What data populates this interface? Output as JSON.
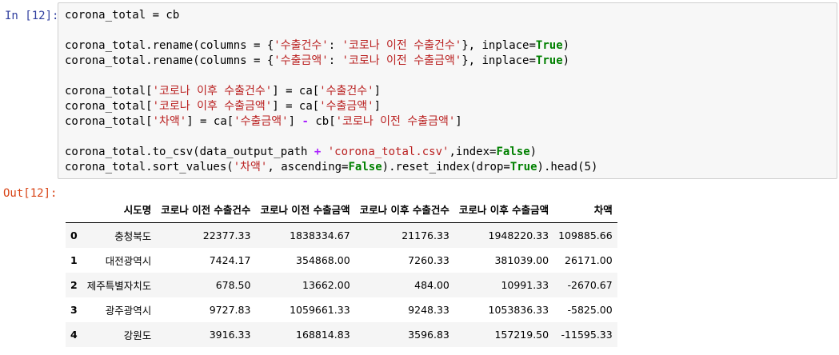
{
  "cell": {
    "in_prompt": "In [12]:",
    "out_prompt": "Out[12]:",
    "code_lines": [
      [
        {
          "t": "corona_total = cb"
        }
      ],
      [],
      [
        {
          "t": "corona_total.rename(columns = {"
        },
        {
          "t": "'수출건수'",
          "c": "str"
        },
        {
          "t": ": "
        },
        {
          "t": "'코로나 이전 수출건수'",
          "c": "str"
        },
        {
          "t": "}, inplace="
        },
        {
          "t": "True",
          "c": "kw"
        },
        {
          "t": ")"
        }
      ],
      [
        {
          "t": "corona_total.rename(columns = {"
        },
        {
          "t": "'수출금액'",
          "c": "str"
        },
        {
          "t": ": "
        },
        {
          "t": "'코로나 이전 수출금액'",
          "c": "str"
        },
        {
          "t": "}, inplace="
        },
        {
          "t": "True",
          "c": "kw"
        },
        {
          "t": ")"
        }
      ],
      [],
      [
        {
          "t": "corona_total["
        },
        {
          "t": "'코로나 이후 수출건수'",
          "c": "str"
        },
        {
          "t": "] = ca["
        },
        {
          "t": "'수출건수'",
          "c": "str"
        },
        {
          "t": "]"
        }
      ],
      [
        {
          "t": "corona_total["
        },
        {
          "t": "'코로나 이후 수출금액'",
          "c": "str"
        },
        {
          "t": "] = ca["
        },
        {
          "t": "'수출금액'",
          "c": "str"
        },
        {
          "t": "]"
        }
      ],
      [
        {
          "t": "corona_total["
        },
        {
          "t": "'차액'",
          "c": "str"
        },
        {
          "t": "] = ca["
        },
        {
          "t": "'수출금액'",
          "c": "str"
        },
        {
          "t": "] "
        },
        {
          "t": "-",
          "c": "op"
        },
        {
          "t": " cb["
        },
        {
          "t": "'코로나 이전 수출금액'",
          "c": "str"
        },
        {
          "t": "]"
        }
      ],
      [],
      [
        {
          "t": "corona_total.to_csv(data_output_path "
        },
        {
          "t": "+",
          "c": "op"
        },
        {
          "t": " "
        },
        {
          "t": "'corona_total.csv'",
          "c": "str"
        },
        {
          "t": ",index="
        },
        {
          "t": "False",
          "c": "kw"
        },
        {
          "t": ")"
        }
      ],
      [
        {
          "t": "corona_total.sort_values("
        },
        {
          "t": "'차액'",
          "c": "str"
        },
        {
          "t": ", ascending="
        },
        {
          "t": "False",
          "c": "kw"
        },
        {
          "t": ").reset_index(drop="
        },
        {
          "t": "True",
          "c": "kw"
        },
        {
          "t": ").head(5)"
        }
      ]
    ]
  },
  "output_table": {
    "columns": [
      "",
      "시도명",
      "코로나 이전 수출건수",
      "코로나 이전 수출금액",
      "코로나 이후 수출건수",
      "코로나 이후 수출금액",
      "차액"
    ],
    "rows": [
      [
        "0",
        "충청북도",
        "22377.33",
        "1838334.67",
        "21176.33",
        "1948220.33",
        "109885.66"
      ],
      [
        "1",
        "대전광역시",
        "7424.17",
        "354868.00",
        "7260.33",
        "381039.00",
        "26171.00"
      ],
      [
        "2",
        "제주특별자치도",
        "678.50",
        "13662.00",
        "484.00",
        "10991.33",
        "-2670.67"
      ],
      [
        "3",
        "광주광역시",
        "9727.83",
        "1059661.33",
        "9248.33",
        "1053836.33",
        "-5825.00"
      ],
      [
        "4",
        "강원도",
        "3916.33",
        "168814.83",
        "3596.83",
        "157219.50",
        "-11595.33"
      ]
    ]
  }
}
